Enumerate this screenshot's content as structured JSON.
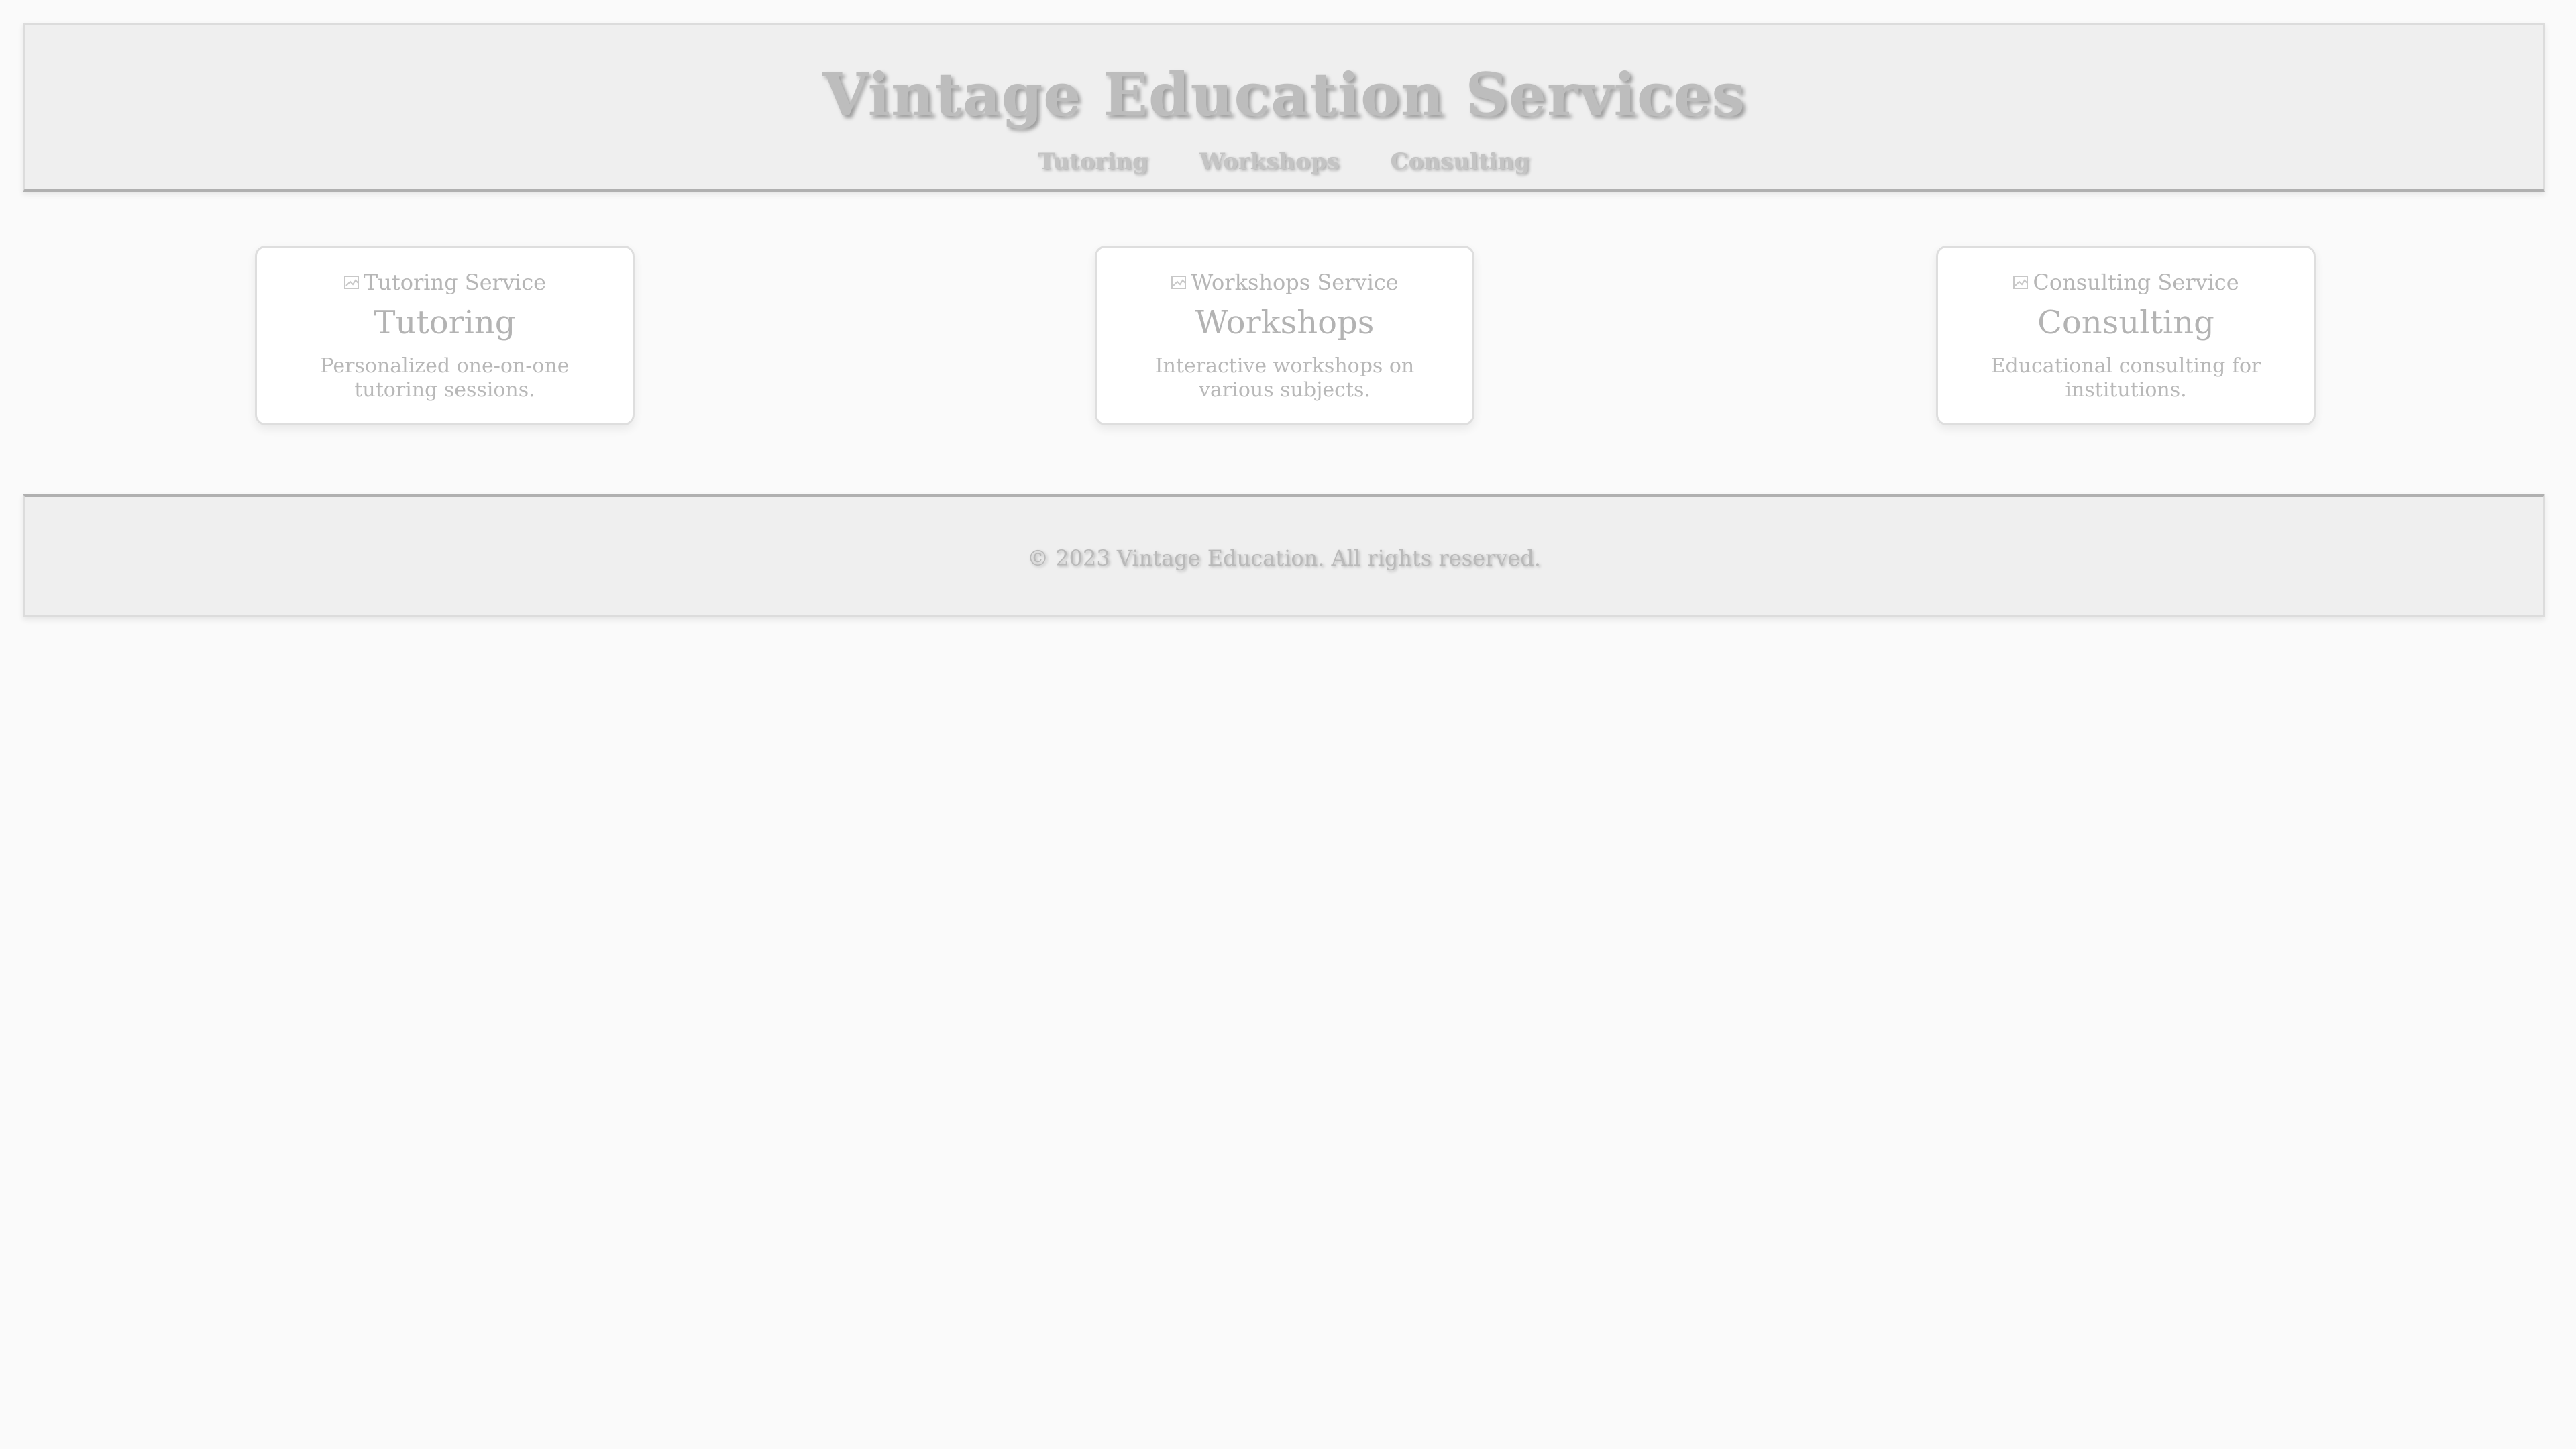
{
  "header": {
    "title": "Vintage Education Services",
    "nav": [
      "Tutoring",
      "Workshops",
      "Consulting"
    ]
  },
  "services": [
    {
      "image_alt": "Tutoring Service",
      "title": "Tutoring",
      "description": "Personalized one-on-one tutoring sessions."
    },
    {
      "image_alt": "Workshops Service",
      "title": "Workshops",
      "description": "Interactive workshops on various subjects."
    },
    {
      "image_alt": "Consulting Service",
      "title": "Consulting",
      "description": "Educational consulting for institutions."
    }
  ],
  "footer": {
    "copyright": "© 2023 Vintage Education. All rights reserved."
  },
  "colors": {
    "background": "#fafafa",
    "panel": "#efefef",
    "text_muted": "#b8b8b8"
  }
}
